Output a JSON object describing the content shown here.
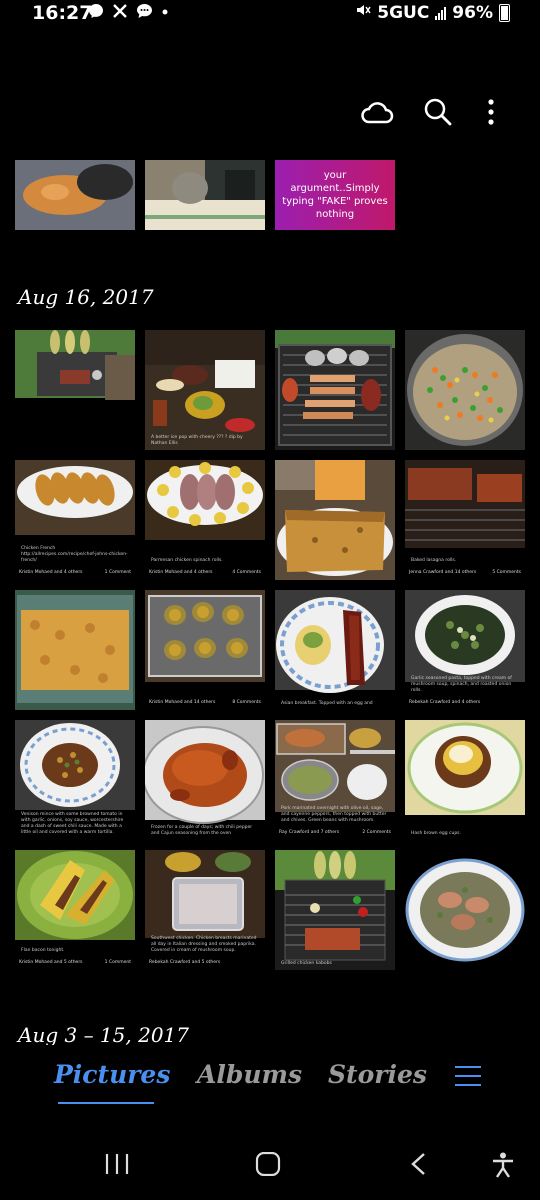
{
  "status": {
    "time": "16:27",
    "network": "5GUC",
    "battery": "96%",
    "icons_left": [
      "messenger-icon",
      "x-icon",
      "chat-icon",
      "dot-icon"
    ]
  },
  "toolbar": {
    "icons": [
      "cloud-icon",
      "search-icon",
      "more-icon"
    ]
  },
  "gallery": {
    "top_row_meme_text": [
      "your",
      "argument..Simply",
      "typing \"FAKE\" proves",
      "nothing"
    ],
    "sections": [
      {
        "date": "Aug 16, 2017",
        "captions": {
          "r1c2": "A better ice pop with cheery ??? ? dip by Nathan Ellis",
          "r2c1": "Chicken French http://allrecipes.com/recipe/chef-johns-chicken-french/",
          "r2c1_author": "Kristin Mohaed and 4 others",
          "r2c1_comments": "1 Comment",
          "r2c2": "Parmesan chicken spinach rolls.",
          "r2c2_author": "Kristin Mohaed and 4 others",
          "r2c2_comments": "4 Comments",
          "r2c4": "Baked lasagna rolls.",
          "r2c4_author": "Jenna Crawford and 14 others",
          "r2c4_comments": "5 Comments",
          "r3c2_author": "Kristin Mohaed and 14 others",
          "r3c2_comments": "8 Comments",
          "r3c3": "Asian breakfast. Topped with an egg and",
          "r3c4": "Garlic seasoned pasta, topped with cream of mushroom soup, spinach, and roasted onion rolls.",
          "r3c4_author": "Rebekah Crawford and 4 others",
          "r4c1": "Venison mince with some browned tomato in with garlic, onions, soy sauce, worcestershire and a dash of sweet chili sauce. Made with a little oil and covered with a warm tortilla.",
          "r4c2": "Frozen for a couple of days; with chili pepper and Cajun seasoning from the oven",
          "r4c3": "Pork marinated overnight with olive oil, sage, and cayenne peppers, then topped with butter and chives. Green beans with mushroom.",
          "r4c3_author": "Ray Crawford and 7 others",
          "r4c3_comments": "2 Comments",
          "r4c4": "Hash brown egg cups.",
          "r5c1": "Flan bacon tonight.",
          "r5c1_author": "Kristin Mohaed and 5 others",
          "r5c1_comments": "1 Comment",
          "r5c2": "Southwest chicken. Chicken breasts marinated all day in Italian dressing and smoked paprika. Covered in cream of mushroom soup.",
          "r5c2_author": "Rebekah Crawford and 5 others",
          "r5c3": "Grilled chicken kabobs",
          "r5c4": ""
        }
      },
      {
        "date": "Aug 3 – 15, 2017"
      }
    ]
  },
  "tabs": {
    "pictures": "Pictures",
    "albums": "Albums",
    "stories": "Stories",
    "active": "pictures"
  },
  "navbar": {
    "icons": [
      "recents-icon",
      "home-icon",
      "back-icon",
      "accessibility-icon"
    ]
  },
  "colors": {
    "background": "#000000",
    "accent": "#4a90f0",
    "tab_inactive": "#9a9a9a",
    "meme_gradient_start": "#9b1fb0",
    "meme_gradient_end": "#c0186a"
  }
}
